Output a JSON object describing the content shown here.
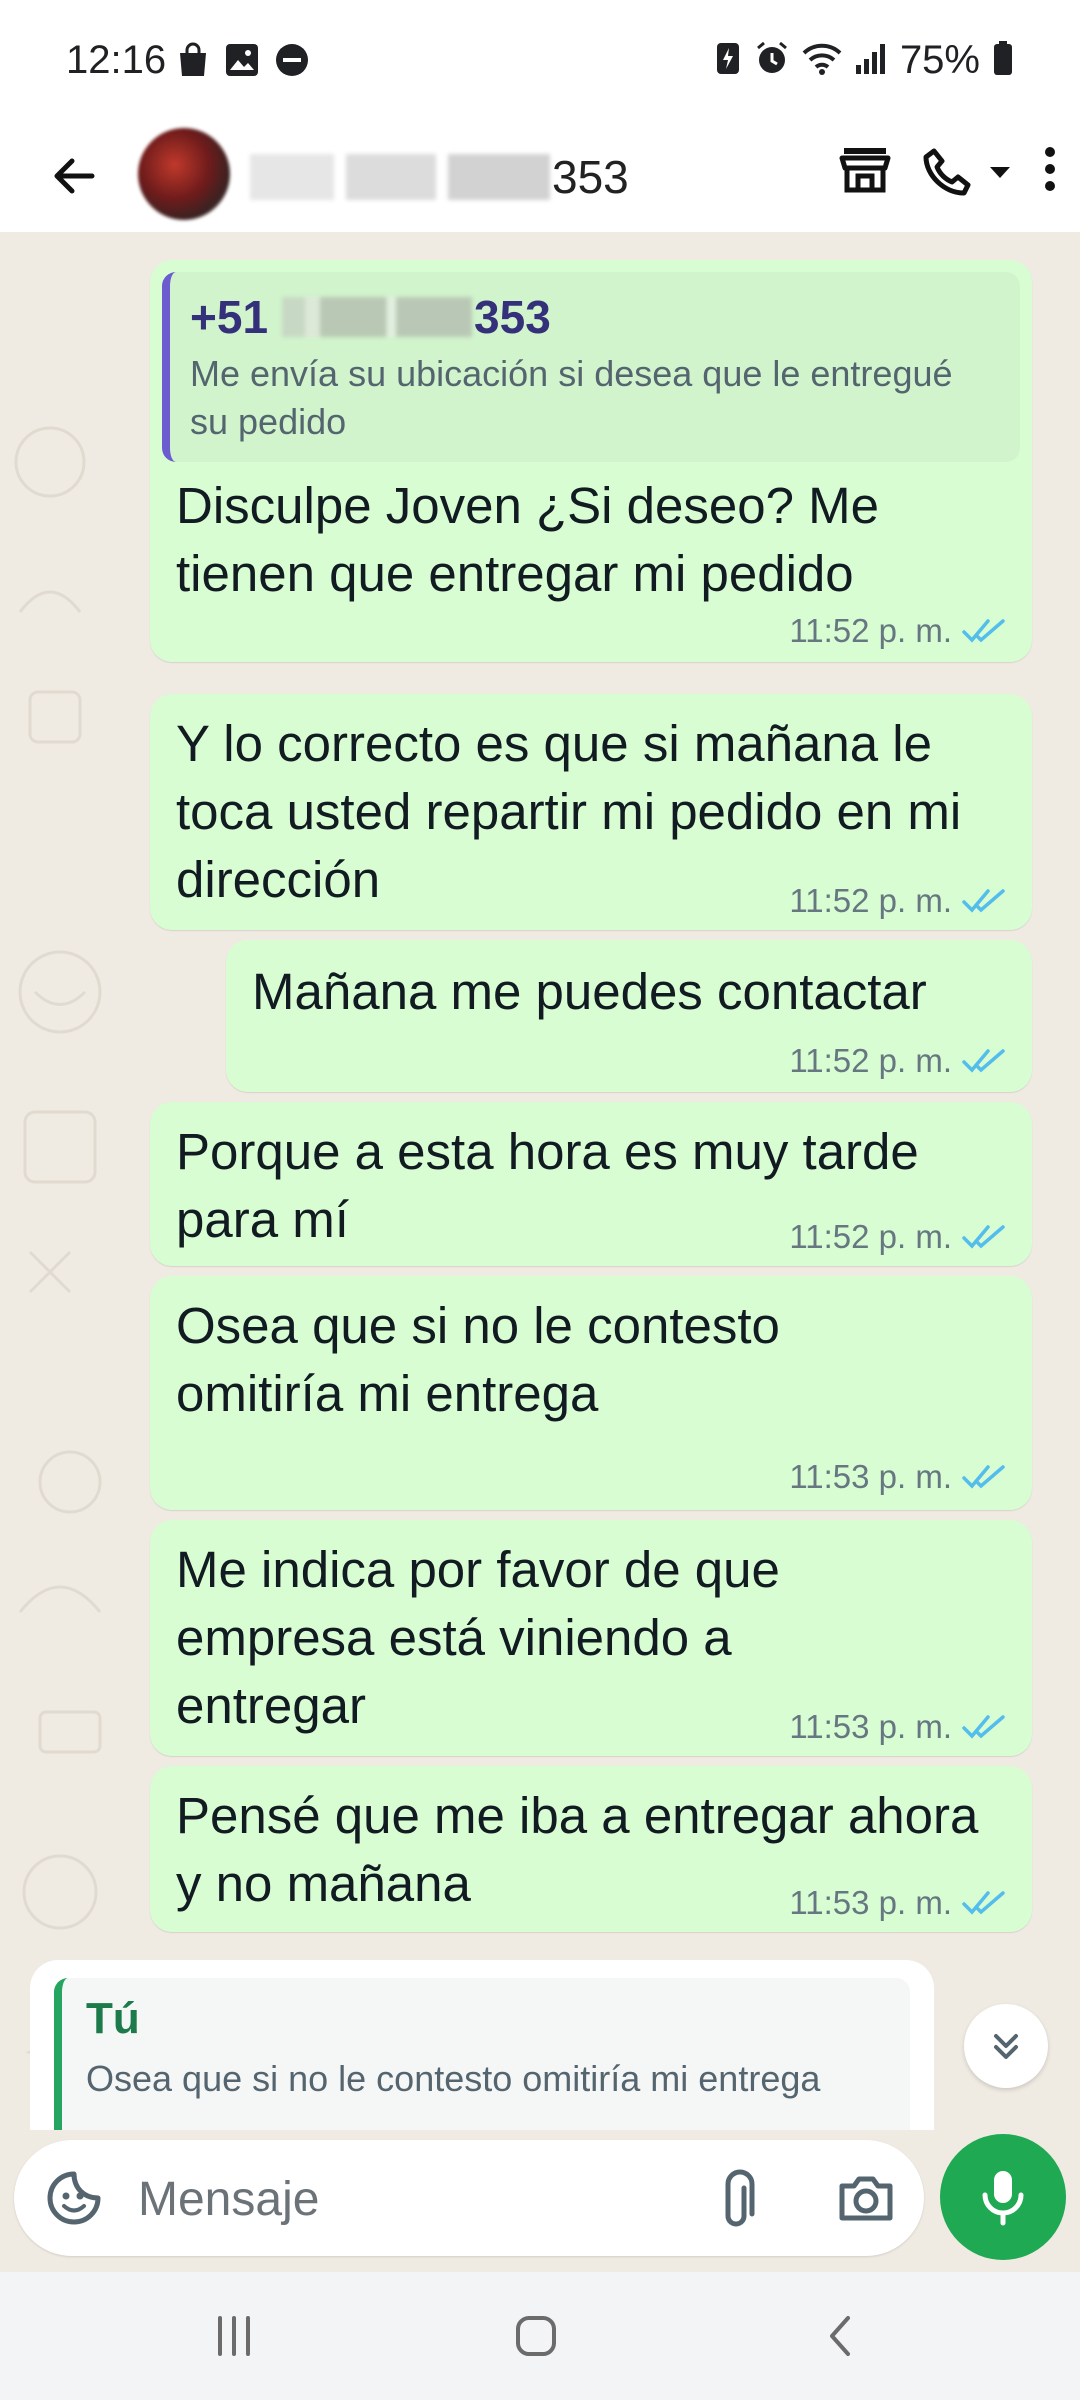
{
  "status_bar": {
    "time": "12:16",
    "battery": "75%",
    "left_icons": [
      "shopping-bag-icon",
      "gallery-icon",
      "do-not-disturb-icon"
    ],
    "right_icons": [
      "battery-saver-icon",
      "alarm-icon",
      "wifi-icon",
      "signal-icon",
      "battery-icon"
    ]
  },
  "header": {
    "contact_suffix": "353",
    "icons": [
      "back-arrow-icon",
      "store-icon",
      "phone-icon",
      "dropdown-icon",
      "more-vert-icon"
    ]
  },
  "messages": [
    {
      "quote": {
        "author_prefix": "+51",
        "author_suffix": "353",
        "text": "Me envía su ubicación si desea que le entregué su pedido"
      },
      "text": "Disculpe Joven ¿Si deseo? Me tienen que entregar mi pedido",
      "time": "11:52 p. m."
    },
    {
      "text": "Y lo correcto es que si mañana le toca usted repartir mi pedido en mi dirección",
      "time": "11:52 p. m."
    },
    {
      "text": "Mañana me puedes contactar",
      "time": "11:52 p. m."
    },
    {
      "text": "Porque a esta hora es muy tarde para mí",
      "time": "11:52 p. m."
    },
    {
      "text": "Osea que si no le contesto omitiría mi entrega",
      "time": "11:53 p. m."
    },
    {
      "text": "Me indica por favor de que empresa está viniendo a entregar",
      "time": "11:53 p. m."
    },
    {
      "text": "Pensé que me iba a entregar ahora y no mañana",
      "time": "11:53 p. m."
    }
  ],
  "reply_preview": {
    "author": "Tú",
    "text": "Osea que si no le contesto omitiría mi entrega"
  },
  "composer": {
    "placeholder": "Mensaje"
  },
  "colors": {
    "bubble_out": "#d9fdd3",
    "chat_bg": "#efeae2",
    "read_ticks": "#53bdeb",
    "accent_green": "#1ea952",
    "quote_bar": "#6b5ccf"
  }
}
